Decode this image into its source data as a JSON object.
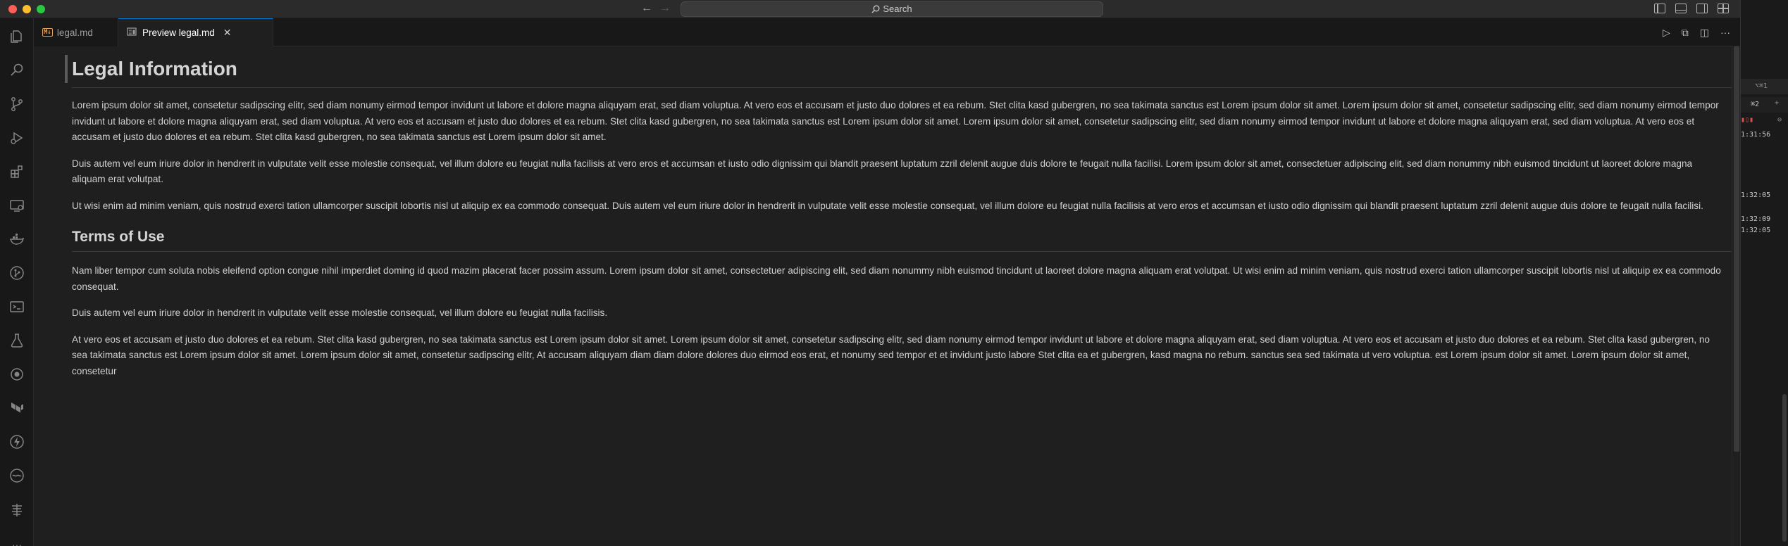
{
  "window": {
    "search_label": "Search"
  },
  "tabs": [
    {
      "label": "legal.md",
      "icon": "markdown-icon"
    },
    {
      "label": "Preview legal.md",
      "icon": "preview-icon"
    }
  ],
  "document": {
    "h1": "Legal Information",
    "p1": "Lorem ipsum dolor sit amet, consetetur sadipscing elitr, sed diam nonumy eirmod tempor invidunt ut labore et dolore magna aliquyam erat, sed diam voluptua. At vero eos et accusam et justo duo dolores et ea rebum. Stet clita kasd gubergren, no sea takimata sanctus est Lorem ipsum dolor sit amet. Lorem ipsum dolor sit amet, consetetur sadipscing elitr, sed diam nonumy eirmod tempor invidunt ut labore et dolore magna aliquyam erat, sed diam voluptua. At vero eos et accusam et justo duo dolores et ea rebum. Stet clita kasd gubergren, no sea takimata sanctus est Lorem ipsum dolor sit amet. Lorem ipsum dolor sit amet, consetetur sadipscing elitr, sed diam nonumy eirmod tempor invidunt ut labore et dolore magna aliquyam erat, sed diam voluptua. At vero eos et accusam et justo duo dolores et ea rebum. Stet clita kasd gubergren, no sea takimata sanctus est Lorem ipsum dolor sit amet.",
    "p2": "Duis autem vel eum iriure dolor in hendrerit in vulputate velit esse molestie consequat, vel illum dolore eu feugiat nulla facilisis at vero eros et accumsan et iusto odio dignissim qui blandit praesent luptatum zzril delenit augue duis dolore te feugait nulla facilisi. Lorem ipsum dolor sit amet, consectetuer adipiscing elit, sed diam nonummy nibh euismod tincidunt ut laoreet dolore magna aliquam erat volutpat.",
    "p3": "Ut wisi enim ad minim veniam, quis nostrud exerci tation ullamcorper suscipit lobortis nisl ut aliquip ex ea commodo consequat. Duis autem vel eum iriure dolor in hendrerit in vulputate velit esse molestie consequat, vel illum dolore eu feugiat nulla facilisis at vero eros et accumsan et iusto odio dignissim qui blandit praesent luptatum zzril delenit augue duis dolore te feugait nulla facilisi.",
    "h2": "Terms of Use",
    "p4": "Nam liber tempor cum soluta nobis eleifend option congue nihil imperdiet doming id quod mazim placerat facer possim assum. Lorem ipsum dolor sit amet, consectetuer adipiscing elit, sed diam nonummy nibh euismod tincidunt ut laoreet dolore magna aliquam erat volutpat. Ut wisi enim ad minim veniam, quis nostrud exerci tation ullamcorper suscipit lobortis nisl ut aliquip ex ea commodo consequat.",
    "p5": "Duis autem vel eum iriure dolor in hendrerit in vulputate velit esse molestie consequat, vel illum dolore eu feugiat nulla facilisis.",
    "p6": "At vero eos et accusam et justo duo dolores et ea rebum. Stet clita kasd gubergren, no sea takimata sanctus est Lorem ipsum dolor sit amet. Lorem ipsum dolor sit amet, consetetur sadipscing elitr, sed diam nonumy eirmod tempor invidunt ut labore et dolore magna aliquyam erat, sed diam voluptua. At vero eos et accusam et justo duo dolores et ea rebum. Stet clita kasd gubergren, no sea takimata sanctus est Lorem ipsum dolor sit amet. Lorem ipsum dolor sit amet, consetetur sadipscing elitr, At accusam aliquyam diam diam dolore dolores duo eirmod eos erat, et nonumy sed tempor et et invidunt justo labore Stet clita ea et gubergren, kasd magna no rebum. sanctus sea sed takimata ut vero voluptua. est Lorem ipsum dolor sit amet. Lorem ipsum dolor sit amet, consetetur"
  },
  "side_panel": {
    "shortcut_1": "⌥⌘1",
    "shortcut_2": "⌘2",
    "times": [
      "1:31:56",
      "1:32:05",
      "1:32:09",
      "1:32:05"
    ]
  },
  "colors": {
    "accent": "#0078d4",
    "background": "#1f1f1f"
  }
}
